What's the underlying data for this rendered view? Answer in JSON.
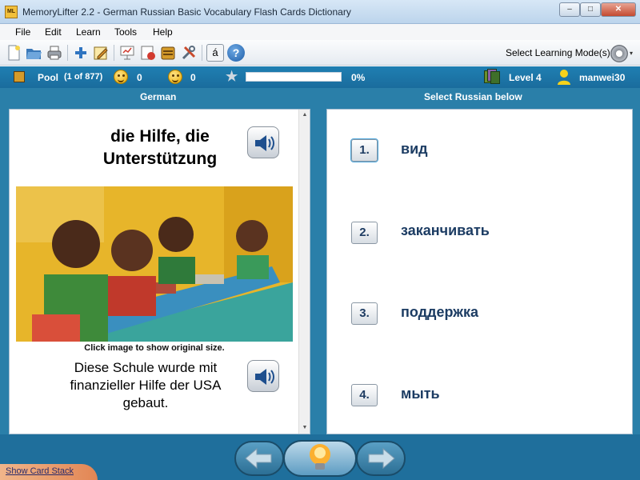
{
  "window": {
    "icon_text": "ML",
    "title": "MemoryLifter 2.2 - German Russian Basic Vocabulary Flash Cards Dictionary",
    "minimize": "–",
    "maximize": "□",
    "close": "✕"
  },
  "menu": [
    "File",
    "Edit",
    "Learn",
    "Tools",
    "Help"
  ],
  "toolbar": {
    "accent_letter": "á",
    "help_glyph": "?",
    "mode_label": "Select Learning Mode(s)",
    "mode_arrow": "▾"
  },
  "status": {
    "pool_label": "Pool",
    "pool_count": "(1 of 877)",
    "right_count": "0",
    "wrong_count": "0",
    "progress_percent": 0,
    "progress_text": "0%",
    "level": "Level 4",
    "user": "manwei30"
  },
  "columns": {
    "left": "German",
    "right": "Select Russian below"
  },
  "card": {
    "word": "die Hilfe, die Unterstützung",
    "caption": "Click image to show original size.",
    "example": "Diese Schule wurde mit finanzieller Hilfe der USA gebaut."
  },
  "answers": [
    {
      "number": "1.",
      "text": "вид"
    },
    {
      "number": "2.",
      "text": "заканчивать"
    },
    {
      "number": "3.",
      "text": "поддержка"
    },
    {
      "number": "4.",
      "text": "мыть"
    }
  ],
  "bottom": {
    "show_card_stack": "Show Card Stack"
  },
  "colors": {
    "status_bar": "#1f7fb2",
    "main_background": "#2a7fa9",
    "answer_text": "#1c3c63",
    "progress_fill": "#35b34a"
  }
}
